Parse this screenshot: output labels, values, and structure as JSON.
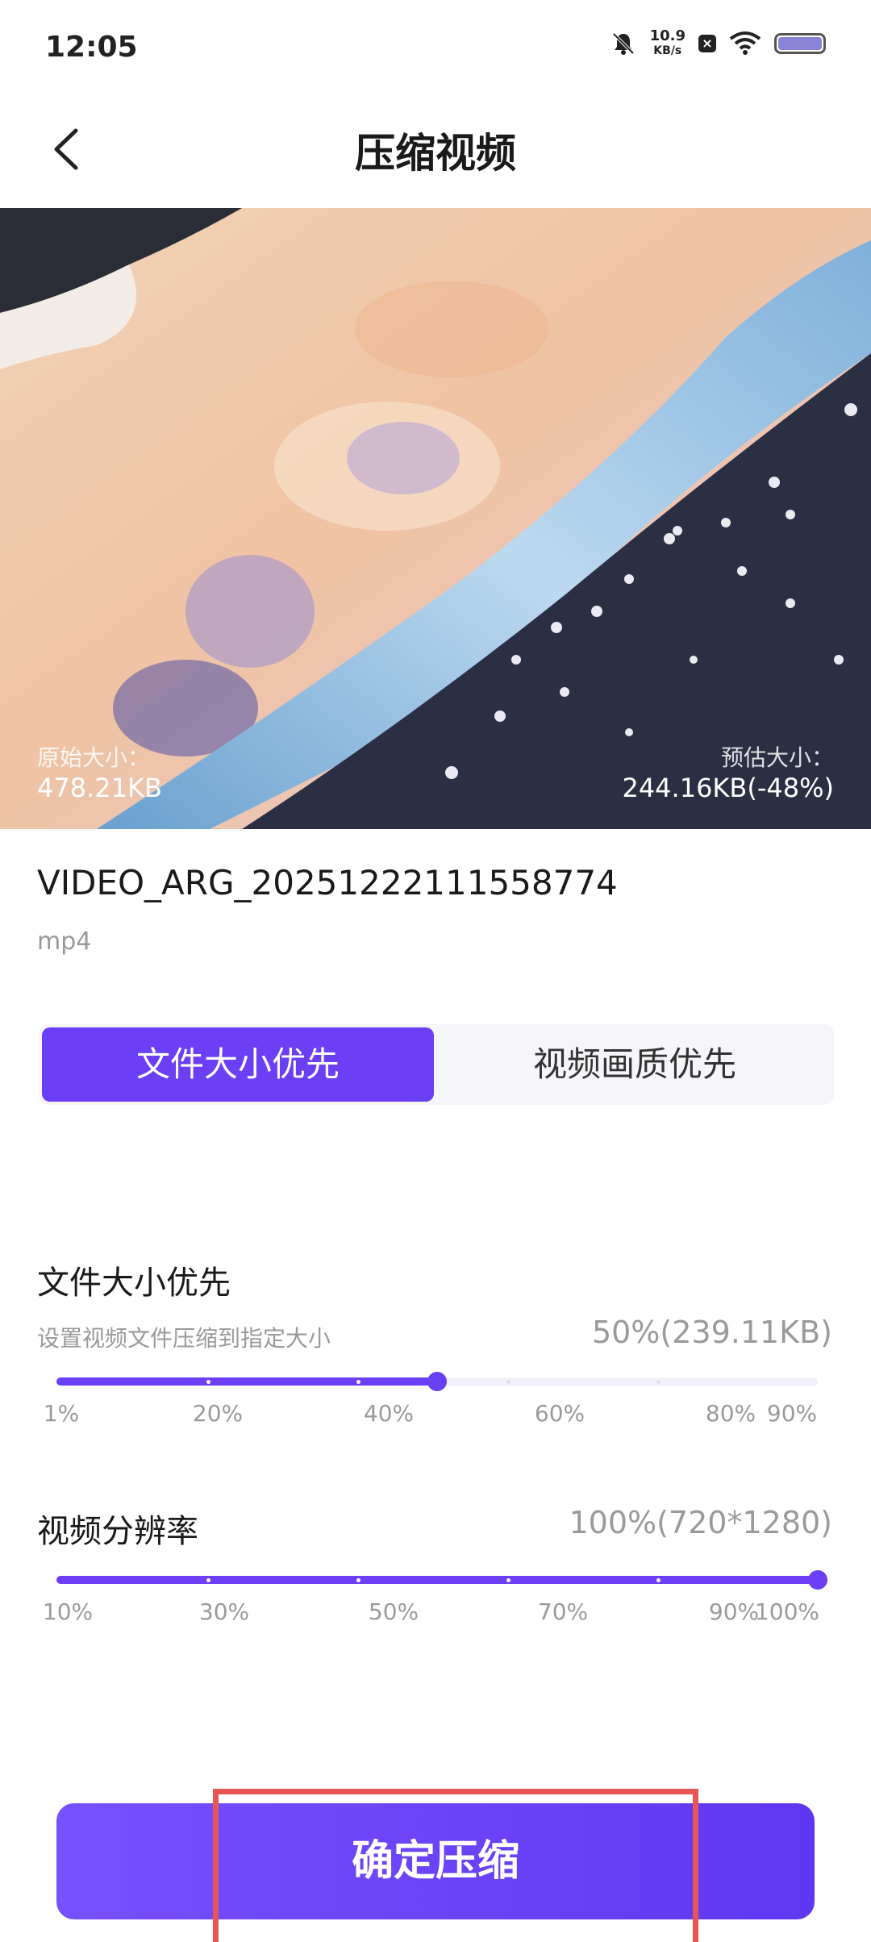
{
  "status_bar": {
    "time": "12:05",
    "net_speed_value": "10.9",
    "net_speed_unit": "KB/s"
  },
  "header": {
    "title": "压缩视频"
  },
  "preview": {
    "original_label": "原始大小：",
    "original_value": "478.21KB",
    "estimated_label": "预估大小：",
    "estimated_value": "244.16KB(-48%)"
  },
  "file": {
    "name": "VIDEO_ARG_20251222111558774",
    "ext": "mp4"
  },
  "mode_tabs": [
    {
      "label": "文件大小优先",
      "active": true
    },
    {
      "label": "视频画质优先",
      "active": false
    }
  ],
  "size_section": {
    "title": "文件大小优先",
    "desc": "设置视频文件压缩到指定大小",
    "value": "50%(239.11KB)",
    "slider_value_percent": 50,
    "ticks": [
      "1%",
      "20%",
      "40%",
      "60%",
      "80%",
      "90%"
    ]
  },
  "resolution_section": {
    "title": "视频分辨率",
    "value": "100%(720*1280)",
    "slider_value_percent": 100,
    "ticks": [
      "10%",
      "30%",
      "50%",
      "70%",
      "90%",
      "100%"
    ]
  },
  "confirm_button": {
    "label": "确定压缩"
  },
  "colors": {
    "accent": "#6a3ff5",
    "highlight": "#e85555"
  }
}
